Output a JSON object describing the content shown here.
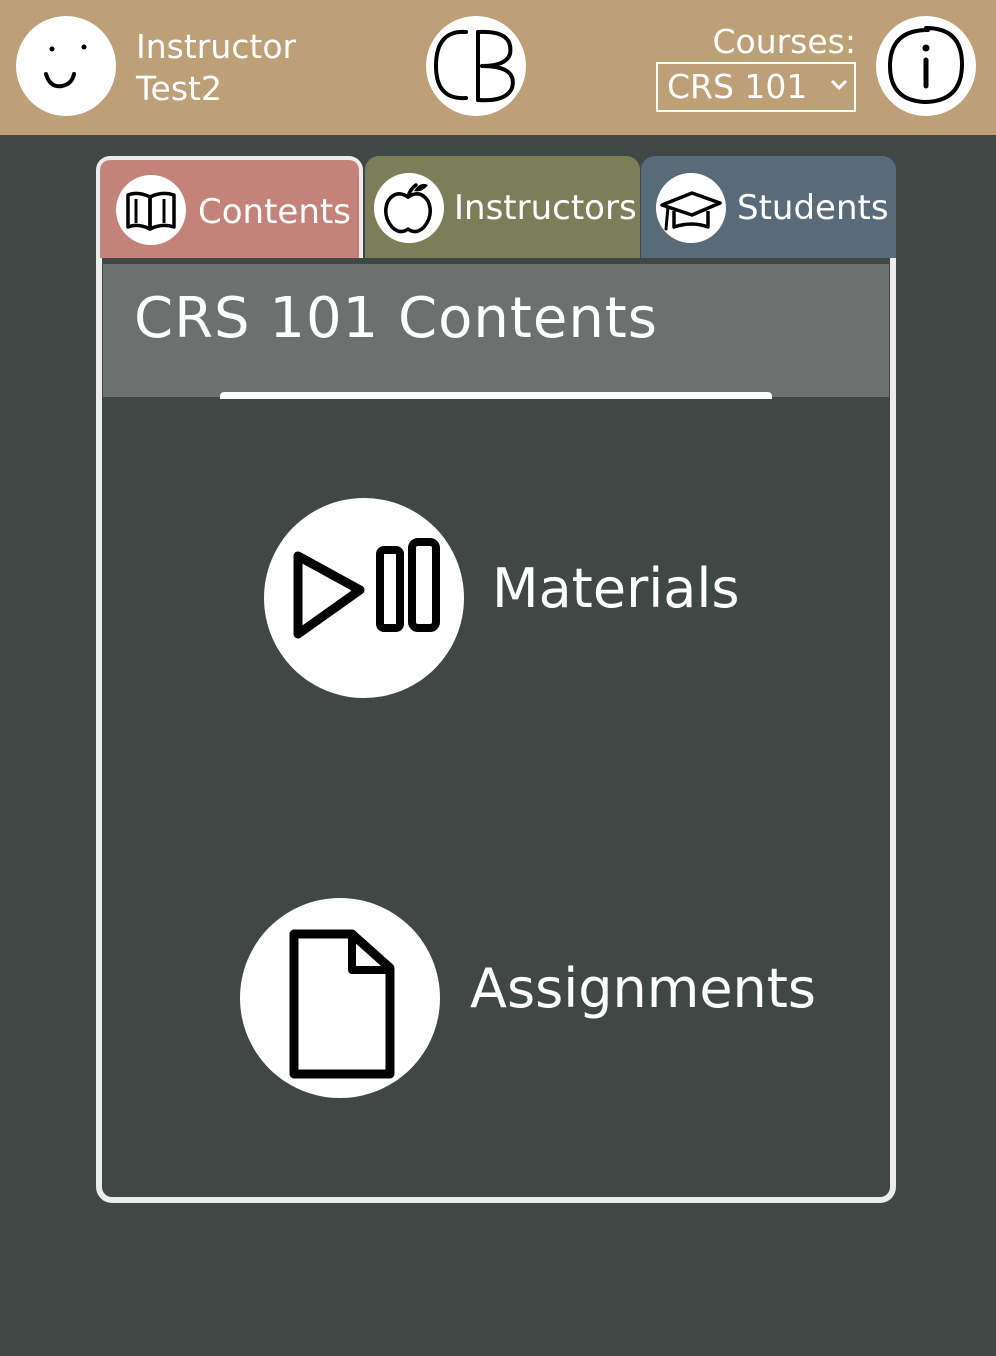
{
  "user": {
    "first_line": "Instructor",
    "second_line": "Test2",
    "avatar_icon": "smiley-face-icon"
  },
  "logo": {
    "text": "CB"
  },
  "courses": {
    "label": "Courses:",
    "selected": "CRS 101"
  },
  "info_icon": "info-icon",
  "tabs": [
    {
      "label": "Contents",
      "icon": "book-icon",
      "color": "#c3837a",
      "active": true
    },
    {
      "label": "Instructors",
      "icon": "apple-icon",
      "color": "#7c7e5a",
      "active": false
    },
    {
      "label": "Students",
      "icon": "graduation-cap-icon",
      "color": "#596b78",
      "active": false
    }
  ],
  "panel": {
    "title": "CRS 101 Contents",
    "items": [
      {
        "label": "Materials",
        "icon": "play-pause-icon"
      },
      {
        "label": "Assignments",
        "icon": "document-icon"
      }
    ]
  },
  "colors": {
    "topbar": "#bd9f78",
    "background": "#404845",
    "panel_header": "#6c706e"
  }
}
